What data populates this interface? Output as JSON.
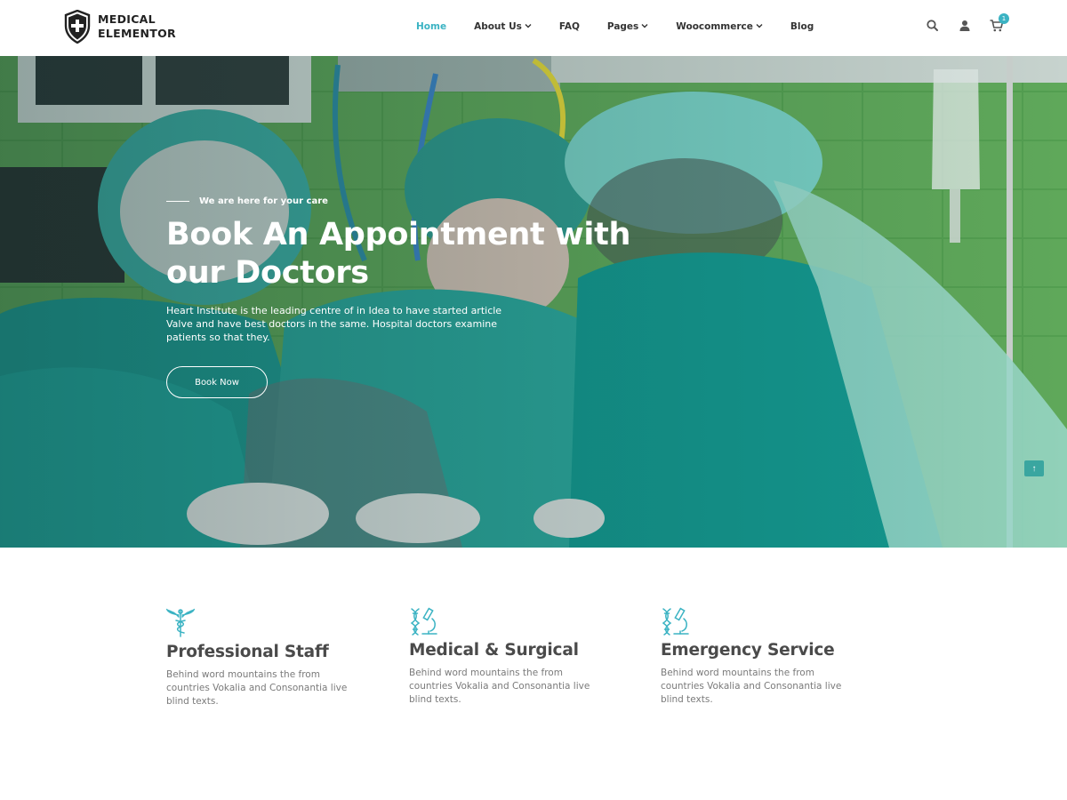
{
  "brand": {
    "line1": "MEDICAL",
    "line2": "ELEMENTOR"
  },
  "nav": {
    "items": [
      {
        "label": "Home",
        "dropdown": false,
        "active": true
      },
      {
        "label": "About Us",
        "dropdown": true,
        "active": false
      },
      {
        "label": "FAQ",
        "dropdown": false,
        "active": false
      },
      {
        "label": "Pages",
        "dropdown": true,
        "active": false
      },
      {
        "label": "Woocommerce",
        "dropdown": true,
        "active": false
      },
      {
        "label": "Blog",
        "dropdown": false,
        "active": false
      }
    ],
    "chevron": "⌄"
  },
  "tools": {
    "search_icon": "search-icon",
    "user_icon": "user-icon",
    "cart_icon": "cart-icon",
    "cart_count": "1"
  },
  "hero": {
    "eyebrow": "We are here for your care",
    "title_line1": "Book An Appointment with",
    "title_line2": "our Doctors",
    "text": "Heart Institute is the leading centre of in Idea to have started article Valve and have best doctors in the same. Hospital doctors examine patients so that they.",
    "button_label": "Book Now",
    "scroll_top_icon": "↑"
  },
  "features": [
    {
      "icon": "caduceus-icon",
      "title": "Professional Staff",
      "text": "Behind word mountains the from countries Vokalia and Consonantia live blind texts."
    },
    {
      "icon": "microscope-icon",
      "title": "Medical & Surgical",
      "text": "Behind word mountains the from countries Vokalia and Consonantia live blind texts."
    },
    {
      "icon": "microscope-icon",
      "title": "Emergency Service",
      "text": "Behind word mountains the from countries Vokalia and Consonantia live blind texts."
    }
  ],
  "colors": {
    "accent": "#3bb3c3",
    "heading": "#4a4a4a",
    "body_text": "#7a7a7a",
    "hero_wall": "#5fa85a",
    "scrubs": "#2aa39a"
  }
}
